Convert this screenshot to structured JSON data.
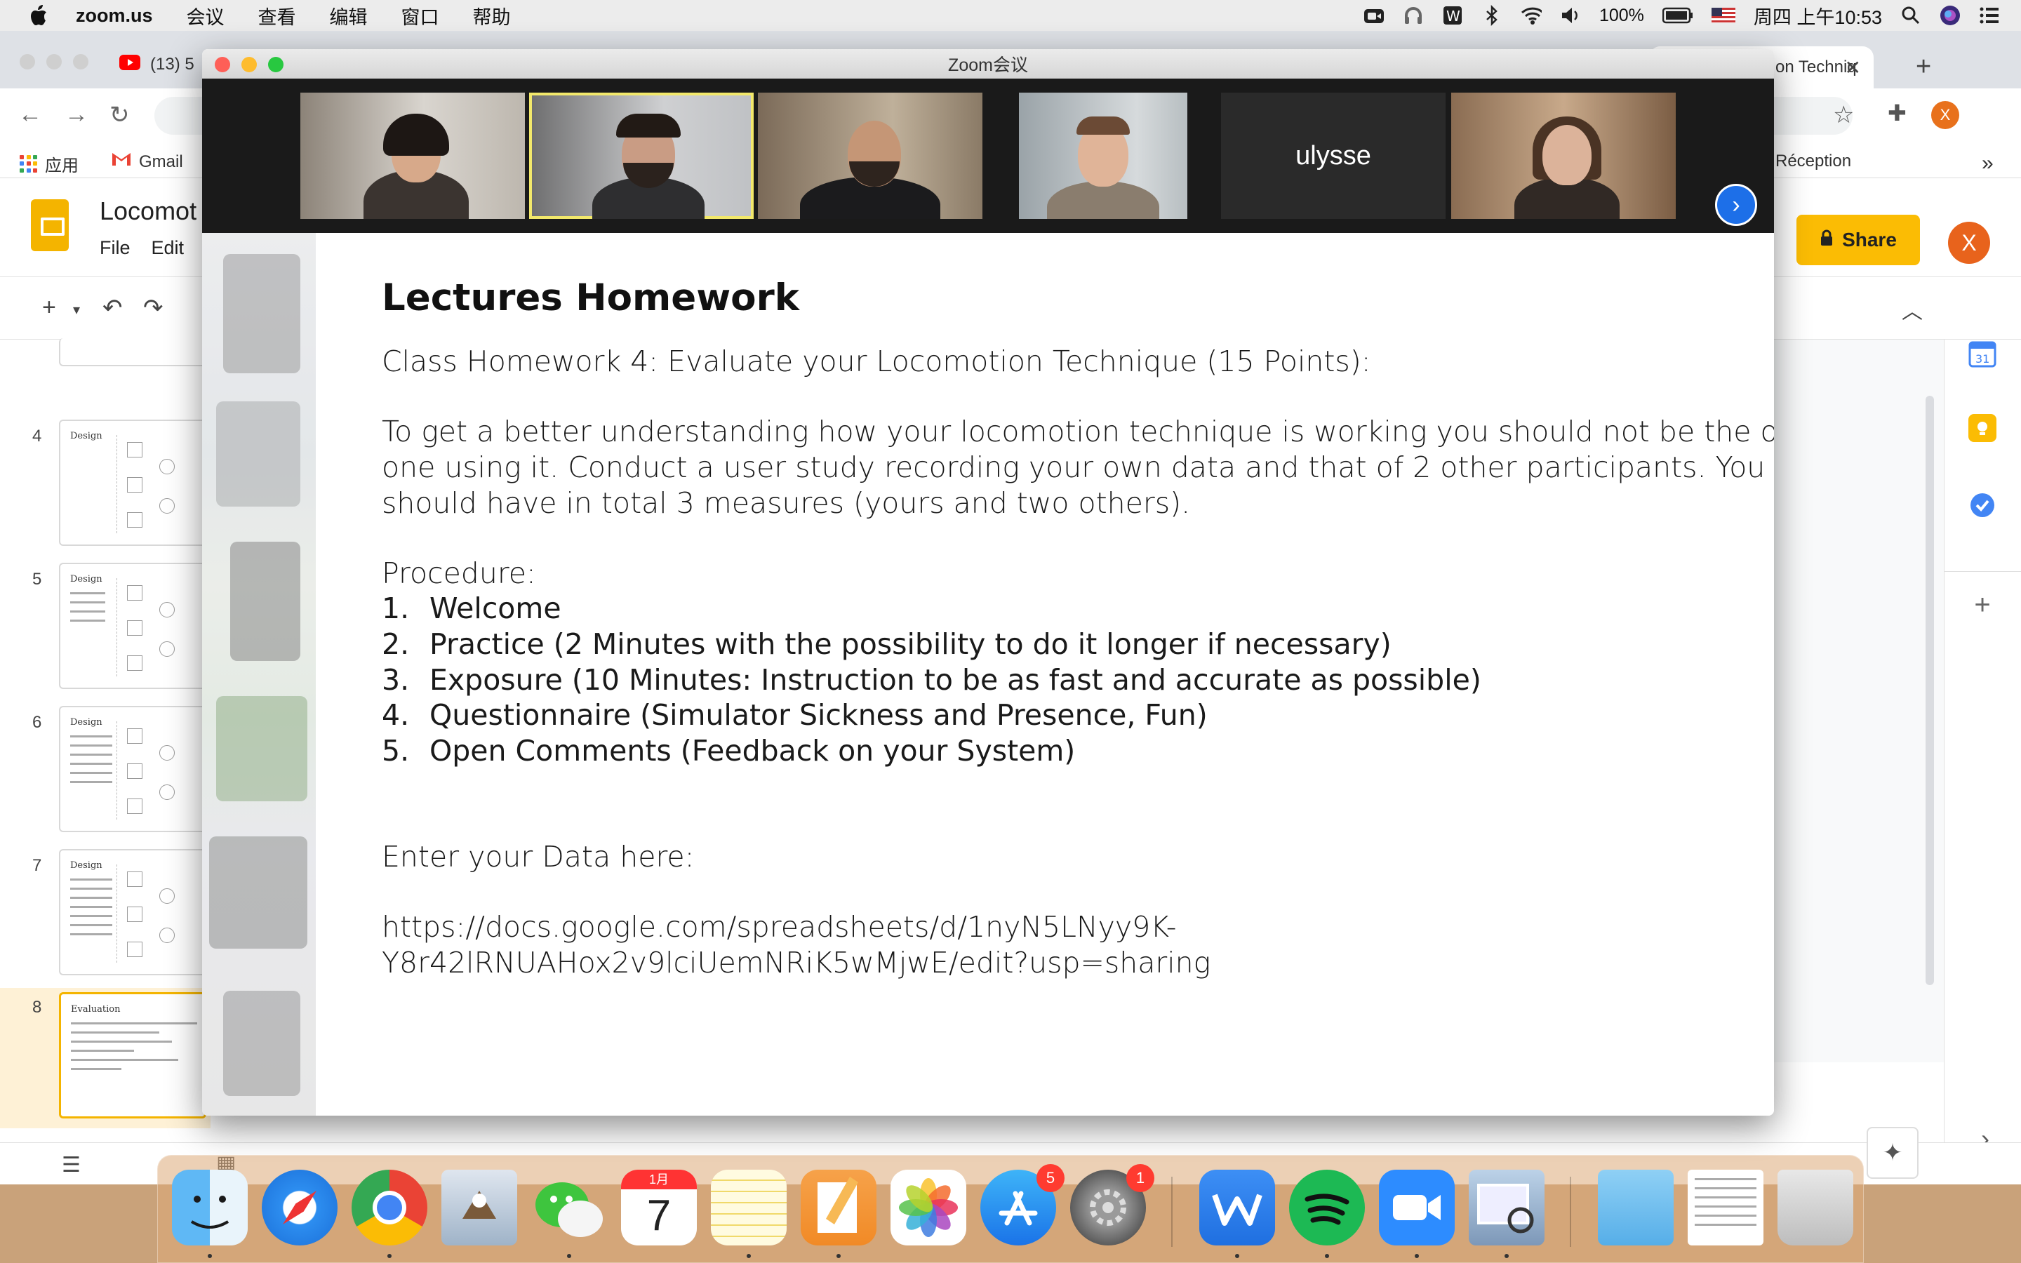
{
  "menubar": {
    "app_name": "zoom.us",
    "menus": [
      "会议",
      "查看",
      "编辑",
      "窗口",
      "帮助"
    ],
    "battery": "100%",
    "datetime": "周四 上午10:53"
  },
  "chrome": {
    "tab_left_label": "(13) 5",
    "tab_right_label": "on Techniq",
    "bookmarks": {
      "apps": "应用",
      "gmail": "Gmail",
      "reception": "Réception"
    },
    "profile_initial": "X"
  },
  "slides": {
    "doc_title": "Locomot",
    "menu": [
      "File",
      "Edit"
    ],
    "share_label": "Share",
    "avatar_initial": "X",
    "thumbnails": [
      {
        "num": "4",
        "title": "Design"
      },
      {
        "num": "5",
        "title": "Design"
      },
      {
        "num": "6",
        "title": "Design"
      },
      {
        "num": "7",
        "title": "Design"
      },
      {
        "num": "8",
        "title": "Evaluation"
      }
    ]
  },
  "zoom": {
    "window_title": "Zoom会议",
    "participant_name": "ulysse",
    "slide": {
      "title": "Lectures Homework",
      "subtitle": "Class Homework 4: Evaluate your Locomotion Technique (15 Points):",
      "paragraph": [
        "To get a better understanding how your locomotion technique is working you should not be the only",
        "one using it. Conduct a user study recording your own data and that of 2 other participants. You",
        "should have in total 3 measures (yours and two others)."
      ],
      "procedure_label": "Procedure:",
      "procedure": [
        {
          "n": "1.",
          "text": "Welcome"
        },
        {
          "n": "2.",
          "text": "Practice (2 Minutes with the possibility to do it longer if necessary)"
        },
        {
          "n": "3.",
          "text": "Exposure (10 Minutes: Instruction to be as fast and accurate as possible)"
        },
        {
          "n": "4.",
          "text": "Questionnaire (Simulator Sickness and Presence, Fun)"
        },
        {
          "n": "5.",
          "text": "Open Comments (Feedback on your System)"
        }
      ],
      "data_label": "Enter your Data here:",
      "link": [
        "https://docs.google.com/spreadsheets/d/1nyN5LNyy9K-",
        "Y8r42lRNUAHox2v9lciUemNRiK5wMjwE/edit?usp=sharing"
      ]
    }
  },
  "dock": {
    "calendar_month": "1月",
    "calendar_day": "7",
    "appstore_badge": "5",
    "settings_badge": "1"
  },
  "colors": {
    "zoom_blue": "#1d6fe8",
    "slides_yellow": "#fbbc04",
    "active_speaker": "#f2e86b"
  }
}
